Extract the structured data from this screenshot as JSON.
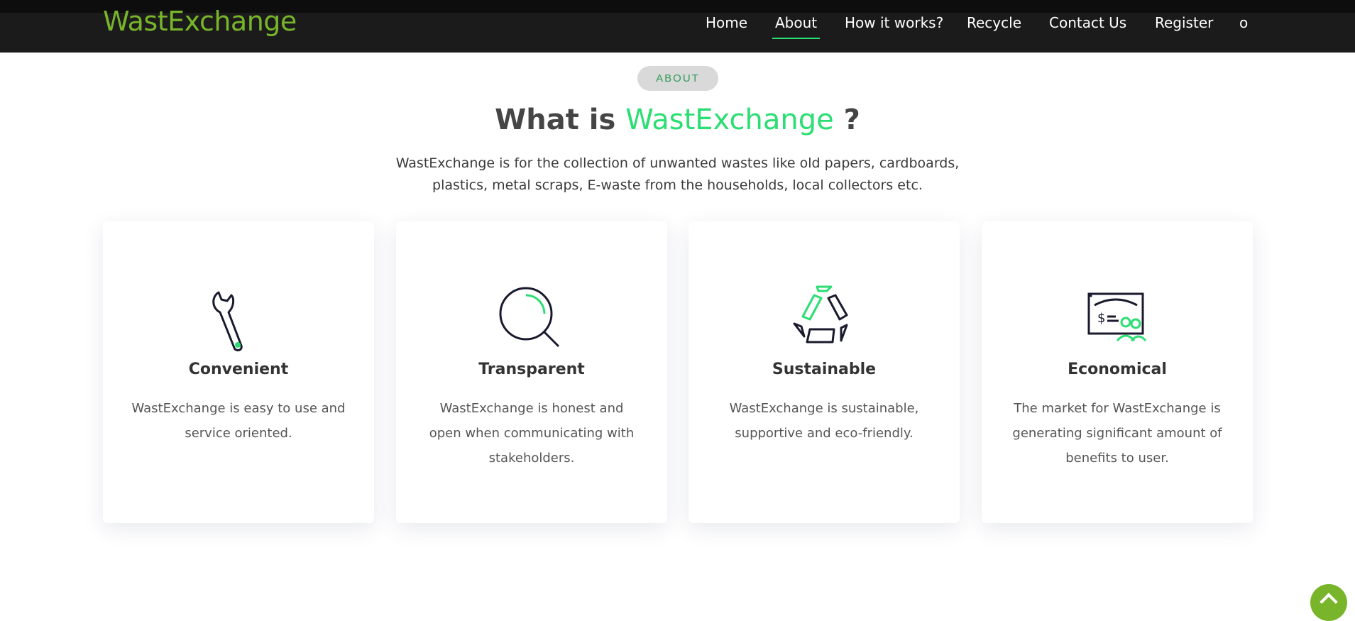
{
  "brand": "WastExchange",
  "nav": [
    {
      "label": "Home"
    },
    {
      "label": "About"
    },
    {
      "label": "How it works?"
    },
    {
      "label": "Recycle"
    },
    {
      "label": "Contact Us"
    },
    {
      "label": "Register"
    },
    {
      "label": "o"
    }
  ],
  "about": {
    "pill": "ABOUT",
    "headline_prefix": "What is",
    "headline_accent": "WastExchange",
    "headline_suffix": "?",
    "lead": "WastExchange is for the collection of unwanted wastes like old papers, cardboards, plastics, metal scraps, E-waste from the households, local collectors etc."
  },
  "features": [
    {
      "title": "Convenient",
      "text": "WastExchange is easy to use and service oriented.",
      "icon": "wrench-icon"
    },
    {
      "title": "Transparent",
      "text": "WastExchange is honest and open when communicating with stakeholders.",
      "icon": "magnifier-icon"
    },
    {
      "title": "Sustainable",
      "text": "WastExchange is sustainable, supportive and eco-friendly.",
      "icon": "recycle-icon"
    },
    {
      "title": "Economical",
      "text": "The market for WastExchange is generating significant amount of benefits to user.",
      "icon": "cheque-icon"
    }
  ],
  "colors": {
    "accent_green": "#2bde73",
    "brand_green": "#78b52a",
    "navbar": "#1b1b1b"
  }
}
